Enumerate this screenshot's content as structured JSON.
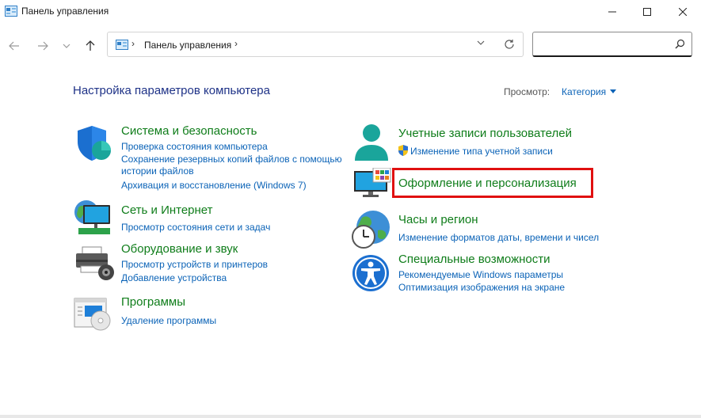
{
  "window": {
    "title": "Панель управления"
  },
  "address": {
    "crumb": "Панель управления",
    "separator": "›"
  },
  "search": {
    "placeholder": ""
  },
  "main": {
    "heading": "Настройка параметров компьютера",
    "view_label": "Просмотр:",
    "view_value": "Категория"
  },
  "categories": {
    "system": {
      "title": "Система и безопасность",
      "links": [
        "Проверка состояния компьютера",
        "Сохранение резервных копий файлов с помощью",
        "истории файлов",
        "Архивация и восстановление (Windows 7)"
      ]
    },
    "network": {
      "title": "Сеть и Интернет",
      "links": [
        "Просмотр состояния сети и задач"
      ]
    },
    "hardware": {
      "title": "Оборудование и звук",
      "links": [
        "Просмотр устройств и принтеров",
        "Добавление устройства"
      ]
    },
    "programs": {
      "title": "Программы",
      "links": [
        "Удаление программы"
      ]
    },
    "users": {
      "title": "Учетные записи пользователей",
      "links": [
        "Изменение типа учетной записи"
      ]
    },
    "appearance": {
      "title": "Оформление и персонализация",
      "links": []
    },
    "clock": {
      "title": "Часы и регион",
      "links": [
        "Изменение форматов даты, времени и чисел"
      ]
    },
    "ease": {
      "title": "Специальные возможности",
      "links": [
        "Рекомендуемые Windows параметры",
        "Оптимизация изображения на экране"
      ]
    }
  },
  "colors": {
    "accent": "#0b63b7",
    "category_title": "#0f7d1a",
    "heading": "#1e3287",
    "highlight": "#e01010"
  }
}
